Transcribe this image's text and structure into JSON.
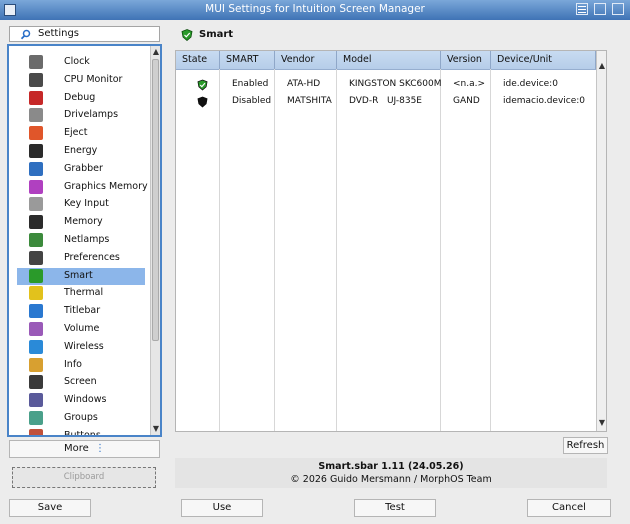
{
  "window": {
    "title": "MUI Settings for Intuition Screen Manager"
  },
  "sidebar": {
    "header_label": "Settings",
    "items": [
      {
        "label": "Clock",
        "icon": "clock-icon",
        "color": "#6b6b6b"
      },
      {
        "label": "CPU Monitor",
        "icon": "cpu-monitor-icon",
        "color": "#4a4a4a"
      },
      {
        "label": "Debug",
        "icon": "debug-icon",
        "color": "#c62828"
      },
      {
        "label": "Drivelamps",
        "icon": "drivelamps-icon",
        "color": "#8a8a8a"
      },
      {
        "label": "Eject",
        "icon": "eject-icon",
        "color": "#e0562a"
      },
      {
        "label": "Energy",
        "icon": "energy-icon",
        "color": "#2b2b2b"
      },
      {
        "label": "Grabber",
        "icon": "grabber-icon",
        "color": "#2f6fc0"
      },
      {
        "label": "Graphics Memory",
        "icon": "graphics-memory-icon",
        "color": "#b040c0"
      },
      {
        "label": "Key Input",
        "icon": "key-input-icon",
        "color": "#9a9a9a"
      },
      {
        "label": "Memory",
        "icon": "memory-icon",
        "color": "#2b2b2b"
      },
      {
        "label": "Netlamps",
        "icon": "netlamps-icon",
        "color": "#3c8a3c"
      },
      {
        "label": "Preferences",
        "icon": "preferences-icon",
        "color": "#444444"
      },
      {
        "label": "Smart",
        "icon": "smart-shield-icon",
        "color": "#2a9a2a"
      },
      {
        "label": "Thermal",
        "icon": "thermal-icon",
        "color": "#e2c21c"
      },
      {
        "label": "Titlebar",
        "icon": "titlebar-icon",
        "color": "#2a78d0"
      },
      {
        "label": "Volume",
        "icon": "volume-icon",
        "color": "#9a5ab8"
      },
      {
        "label": "Wireless",
        "icon": "wireless-icon",
        "color": "#2a8ad8"
      },
      {
        "label": "Info",
        "icon": "info-icon",
        "color": "#d8a030"
      },
      {
        "label": "Screen",
        "icon": "screen-icon",
        "color": "#3a3a3a"
      },
      {
        "label": "Windows",
        "icon": "windows-icon",
        "color": "#5a5a9a"
      },
      {
        "label": "Groups",
        "icon": "groups-icon",
        "color": "#4aa08a"
      },
      {
        "label": "Buttons",
        "icon": "buttons-icon",
        "color": "#c0503a"
      }
    ],
    "selected": "Smart",
    "more_label": "More",
    "more_glyph": "⋮",
    "clipboard_label": "Clipboard"
  },
  "main": {
    "title": "Smart",
    "table": {
      "columns": [
        "State",
        "SMART",
        "Vendor",
        "Model",
        "Version",
        "Device/Unit"
      ],
      "rows": [
        {
          "state": "green-shield",
          "smart": "Enabled",
          "vendor": "ATA-HD",
          "model": "KINGSTON SKC600M",
          "version": "<n.a.>",
          "device": "ide.device:0"
        },
        {
          "state": "black-shield",
          "smart": "Disabled",
          "vendor": "MATSHITA",
          "model": "DVD-R   UJ-835E",
          "version": "GAND",
          "device": "idemacio.device:0"
        }
      ]
    },
    "refresh_label": "Refresh",
    "info": {
      "line1": "Smart.sbar 1.11 (24.05.26)",
      "line2": "© 2026 Guido Mersmann / MorphOS Team"
    }
  },
  "bottom": {
    "save": "Save",
    "use": "Use",
    "test": "Test",
    "cancel": "Cancel"
  },
  "colors": {
    "accent": "#4a84c8",
    "selection": "#8cb6ea",
    "titlebar": "#3f73b5",
    "shield_green": "#2a9a2a"
  }
}
